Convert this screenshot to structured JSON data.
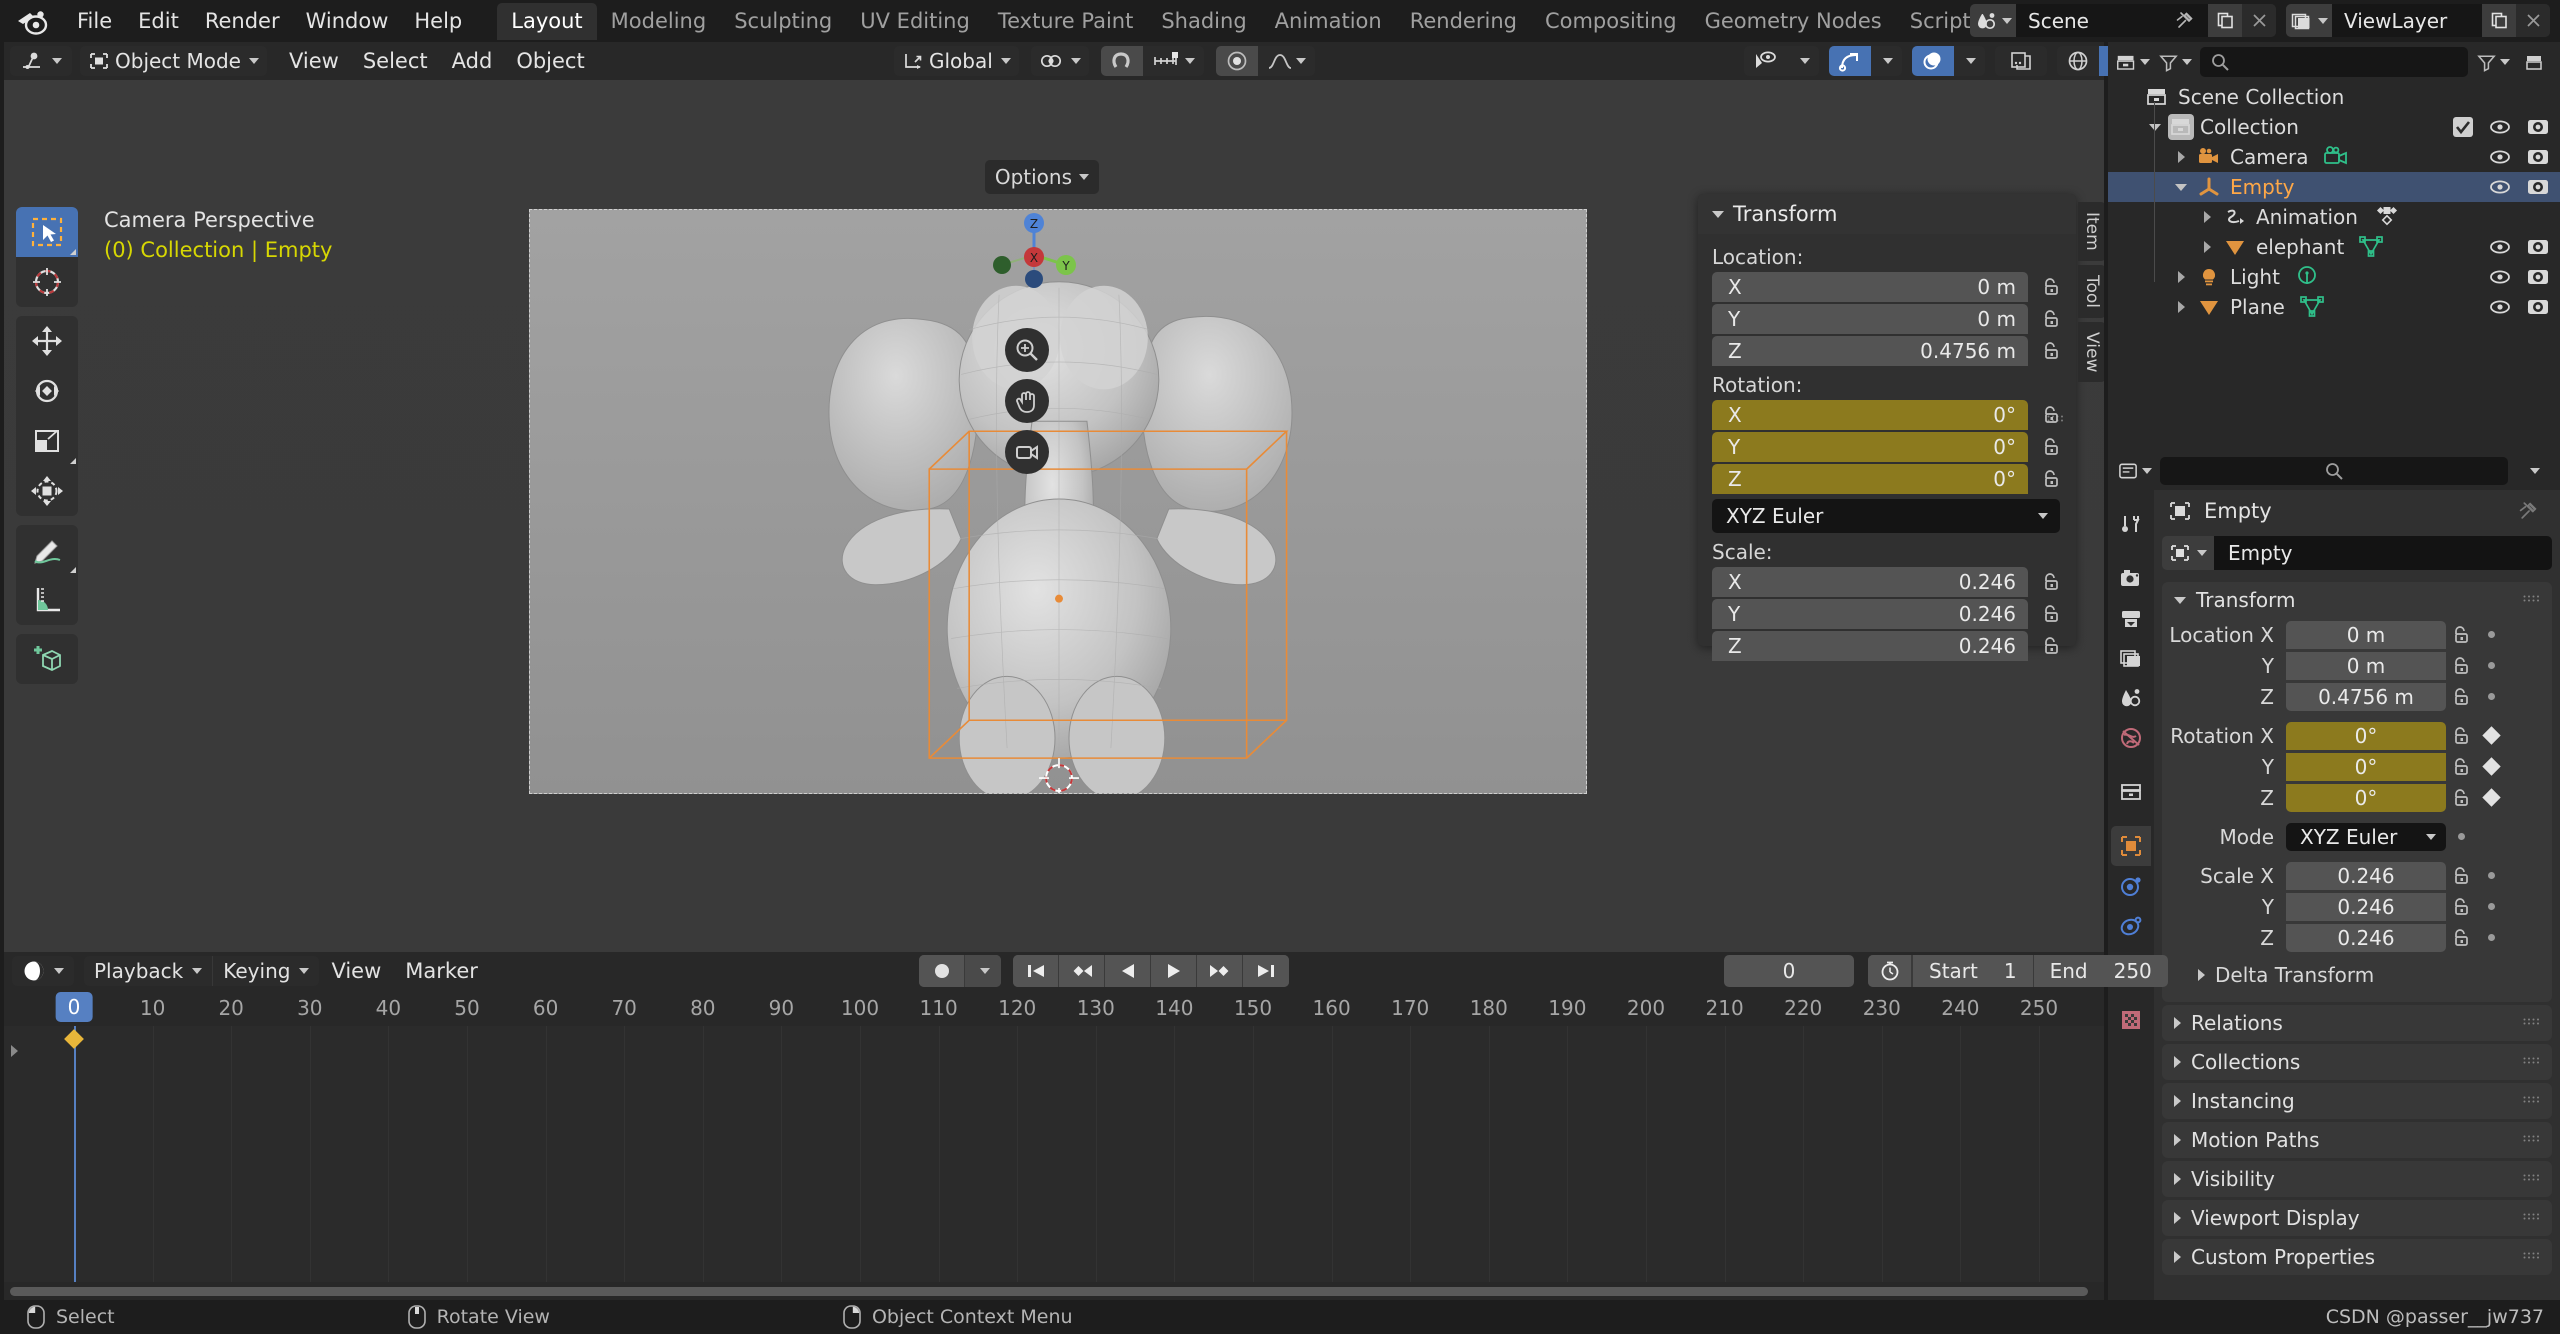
{
  "app": {
    "logo_icon": "blender-logo-icon",
    "menus": [
      "File",
      "Edit",
      "Render",
      "Window",
      "Help"
    ],
    "workspace_tabs": [
      {
        "label": "Layout",
        "active": true
      },
      {
        "label": "Modeling",
        "active": false
      },
      {
        "label": "Sculpting",
        "active": false
      },
      {
        "label": "UV Editing",
        "active": false
      },
      {
        "label": "Texture Paint",
        "active": false
      },
      {
        "label": "Shading",
        "active": false
      },
      {
        "label": "Animation",
        "active": false
      },
      {
        "label": "Rendering",
        "active": false
      },
      {
        "label": "Compositing",
        "active": false
      },
      {
        "label": "Geometry Nodes",
        "active": false
      },
      {
        "label": "Scripting",
        "active": false
      }
    ],
    "add_workspace_label": "+",
    "scene": {
      "icon": "scene-icon",
      "name": "Scene",
      "pin_icon": "pin-icon",
      "copy_icon": "duplicate-icon",
      "close_icon": "x-icon"
    },
    "viewlayer": {
      "icon": "viewlayer-icon",
      "name": "ViewLayer",
      "copy_icon": "duplicate-icon",
      "close_icon": "x-icon"
    }
  },
  "viewport_header": {
    "editor_type_icon": "editor-type-3dview-icon",
    "mode": "Object Mode",
    "menus": [
      "View",
      "Select",
      "Add",
      "Object"
    ],
    "transform_orientation": "Global",
    "orientation_icon": "orientation-icon",
    "pivot_icon": "pivot-point-icon",
    "snap_magnet_icon": "snap-magnet-icon",
    "snap_target_icon": "snap-increment-icon",
    "proportional_icon": "proportional-edit-icon",
    "falloff_icon": "falloff-smooth-icon",
    "visibility_icon": "object-visibility-icon",
    "gizmo_icon": "gizmo-icon",
    "overlays_icon": "overlays-icon",
    "xray_icon": "xray-toggle-icon",
    "shading_modes": [
      "wireframe",
      "solid",
      "material-preview",
      "rendered"
    ],
    "shading_active": "solid",
    "options_label": "Options"
  },
  "viewport": {
    "title": "Camera Perspective",
    "subtitle": "(0) Collection | Empty",
    "tools": [
      {
        "name": "tweak-select-tool",
        "active": true
      },
      {
        "name": "cursor-tool",
        "active": false
      },
      {
        "name": "move-tool",
        "active": false
      },
      {
        "name": "rotate-tool",
        "active": false
      },
      {
        "name": "scale-tool",
        "active": false
      },
      {
        "name": "transform-tool",
        "active": false
      },
      {
        "name": "annotate-tool",
        "active": false
      },
      {
        "name": "measure-tool",
        "active": false
      },
      {
        "name": "add-cube-tool",
        "active": false
      }
    ],
    "nav_gizmo_axes": [
      "X",
      "Y",
      "Z"
    ],
    "nav_buttons": [
      "zoom-icon",
      "pan-hand-icon",
      "camera-view-icon"
    ],
    "side_tabs": [
      "Item",
      "Tool",
      "View"
    ]
  },
  "npanel": {
    "title": "Transform",
    "location_label": "Location:",
    "rotation_label": "Rotation:",
    "scale_label": "Scale:",
    "location": [
      {
        "axis": "X",
        "value": "0 m"
      },
      {
        "axis": "Y",
        "value": "0 m"
      },
      {
        "axis": "Z",
        "value": "0.4756 m"
      }
    ],
    "rotation": [
      {
        "axis": "X",
        "value": "0°"
      },
      {
        "axis": "Y",
        "value": "0°"
      },
      {
        "axis": "Z",
        "value": "0°"
      }
    ],
    "rotation_mode": "XYZ Euler",
    "scale": [
      {
        "axis": "X",
        "value": "0.246"
      },
      {
        "axis": "Y",
        "value": "0.246"
      },
      {
        "axis": "Z",
        "value": "0.246"
      }
    ],
    "lock_icon": "unlocked-padlock-icon",
    "grip_icon": "panel-grip-icon"
  },
  "outliner": {
    "display_mode_icon": "outliner-display-mode-icon",
    "search_icon": "search-icon",
    "filter_icon": "filter-funnel-icon",
    "new_collection_icon": "new-collection-icon",
    "rows": [
      {
        "label": "Scene Collection",
        "icon": "collection-icon",
        "indent": 0,
        "disclosure": "none",
        "selected": false,
        "visible_icons": false
      },
      {
        "label": "Collection",
        "icon": "collection-icon",
        "indent": 1,
        "disclosure": "open",
        "selected": false,
        "visible_icons": true,
        "checkbox": true
      },
      {
        "label": "Camera",
        "icon": "camera-object-icon",
        "indent": 2,
        "disclosure": "closed",
        "selected": false,
        "visible_icons": true,
        "badge": "camera-data-icon"
      },
      {
        "label": "Empty",
        "icon": "empty-axes-icon",
        "indent": 2,
        "disclosure": "open",
        "selected": true,
        "visible_icons": true
      },
      {
        "label": "Animation",
        "icon": "animation-icon",
        "indent": 3,
        "disclosure": "closed",
        "selected": false,
        "visible_icons": false,
        "badge": "keyframe-icon"
      },
      {
        "label": "elephant",
        "icon": "mesh-object-icon",
        "indent": 3,
        "disclosure": "closed",
        "selected": false,
        "visible_icons": true,
        "badge": "mesh-data-icon"
      },
      {
        "label": "Light",
        "icon": "light-object-icon",
        "indent": 2,
        "disclosure": "closed",
        "selected": false,
        "visible_icons": true,
        "badge": "light-data-icon"
      },
      {
        "label": "Plane",
        "icon": "mesh-object-icon",
        "indent": 2,
        "disclosure": "closed",
        "selected": false,
        "visible_icons": true,
        "badge": "mesh-data-icon"
      }
    ],
    "eye_icon": "eye-visibility-icon",
    "camera_icon": "render-visibility-icon"
  },
  "properties": {
    "search_icon": "search-icon",
    "options_chevron_icon": "chevron-down-icon",
    "tabs": [
      {
        "name": "tool-tab",
        "icon": "tool-wrench-icon",
        "active": false
      },
      {
        "name": "render-tab",
        "icon": "render-camera-icon",
        "active": false
      },
      {
        "name": "output-tab",
        "icon": "output-printer-icon",
        "active": false
      },
      {
        "name": "viewlayer-tab",
        "icon": "viewlayer-images-icon",
        "active": false
      },
      {
        "name": "scene-tab",
        "icon": "scene-cone-icon",
        "active": false
      },
      {
        "name": "world-tab",
        "icon": "world-globe-icon",
        "active": false
      },
      {
        "name": "collection-tab",
        "icon": "collection-box-icon",
        "active": false
      },
      {
        "name": "object-tab",
        "icon": "object-square-icon",
        "active": true
      },
      {
        "name": "physics-tab",
        "icon": "physics-orbit-icon",
        "active": false
      },
      {
        "name": "constraints-tab",
        "icon": "constraints-icon",
        "active": false
      },
      {
        "name": "data-tab",
        "icon": "object-data-axes-icon",
        "active": false
      },
      {
        "name": "texture-tab",
        "icon": "texture-checker-icon",
        "active": false
      }
    ],
    "breadcrumb_icon": "object-square-icon",
    "breadcrumb": "Empty",
    "pin_icon": "pin-icon",
    "id_icon": "object-square-icon",
    "id_name": "Empty",
    "transform": {
      "title": "Transform",
      "rows": [
        {
          "label": "Location X",
          "value": "0 m",
          "type": "normal",
          "deco": "dot"
        },
        {
          "label": "Y",
          "value": "0 m",
          "type": "normal",
          "deco": "dot"
        },
        {
          "label": "Z",
          "value": "0.4756 m",
          "type": "normal",
          "deco": "dot"
        }
      ],
      "rotation_rows": [
        {
          "label": "Rotation X",
          "value": "0°",
          "type": "rot",
          "deco": "diamond"
        },
        {
          "label": "Y",
          "value": "0°",
          "type": "rot",
          "deco": "diamond"
        },
        {
          "label": "Z",
          "value": "0°",
          "type": "rot",
          "deco": "diamond"
        }
      ],
      "mode_label": "Mode",
      "mode_value": "XYZ Euler",
      "scale_rows": [
        {
          "label": "Scale X",
          "value": "0.246",
          "type": "normal",
          "deco": "dot"
        },
        {
          "label": "Y",
          "value": "0.246",
          "type": "normal",
          "deco": "dot"
        },
        {
          "label": "Z",
          "value": "0.246",
          "type": "normal",
          "deco": "dot"
        }
      ],
      "delta_label": "Delta Transform"
    },
    "collapsed_panels": [
      "Relations",
      "Collections",
      "Instancing",
      "Motion Paths",
      "Visibility",
      "Viewport Display",
      "Custom Properties"
    ]
  },
  "timeline": {
    "editor_icon": "timeline-editor-icon",
    "menus": [
      "Playback",
      "Keying",
      "View",
      "Marker"
    ],
    "auto_key_icon": "record-dot-icon",
    "playback_buttons": [
      "jump-to-start-icon",
      "jump-to-prev-keyframe-icon",
      "play-reverse-icon",
      "play-icon",
      "jump-to-next-keyframe-icon",
      "jump-to-end-icon"
    ],
    "current_frame": "0",
    "use_preview_range_icon": "stopwatch-icon",
    "start_label": "Start",
    "start_value": "1",
    "end_label": "End",
    "end_value": "250",
    "ruler_ticks": [
      0,
      10,
      20,
      30,
      40,
      50,
      60,
      70,
      80,
      90,
      100,
      110,
      120,
      130,
      140,
      150,
      160,
      170,
      180,
      190,
      200,
      210,
      220,
      230,
      240,
      250
    ],
    "playhead_frame": 0,
    "playhead_label": "0"
  },
  "statusbar": {
    "items": [
      {
        "icon": "mouse-left-button-icon",
        "label": "Select"
      },
      {
        "icon": "mouse-middle-button-icon",
        "label": "Rotate View"
      },
      {
        "icon": "mouse-right-button-icon",
        "label": "Object Context Menu"
      }
    ],
    "watermark": "CSDN @passer__jw737"
  },
  "colors": {
    "accent_blue": "#4772b3",
    "selection_orange": "#ffa847",
    "rotation_yellow": "#8c7a1e",
    "outliner_select": "#3f5171",
    "panel_bg": "#303030",
    "header_bg": "#282828",
    "viewport_bg": "#393939"
  }
}
